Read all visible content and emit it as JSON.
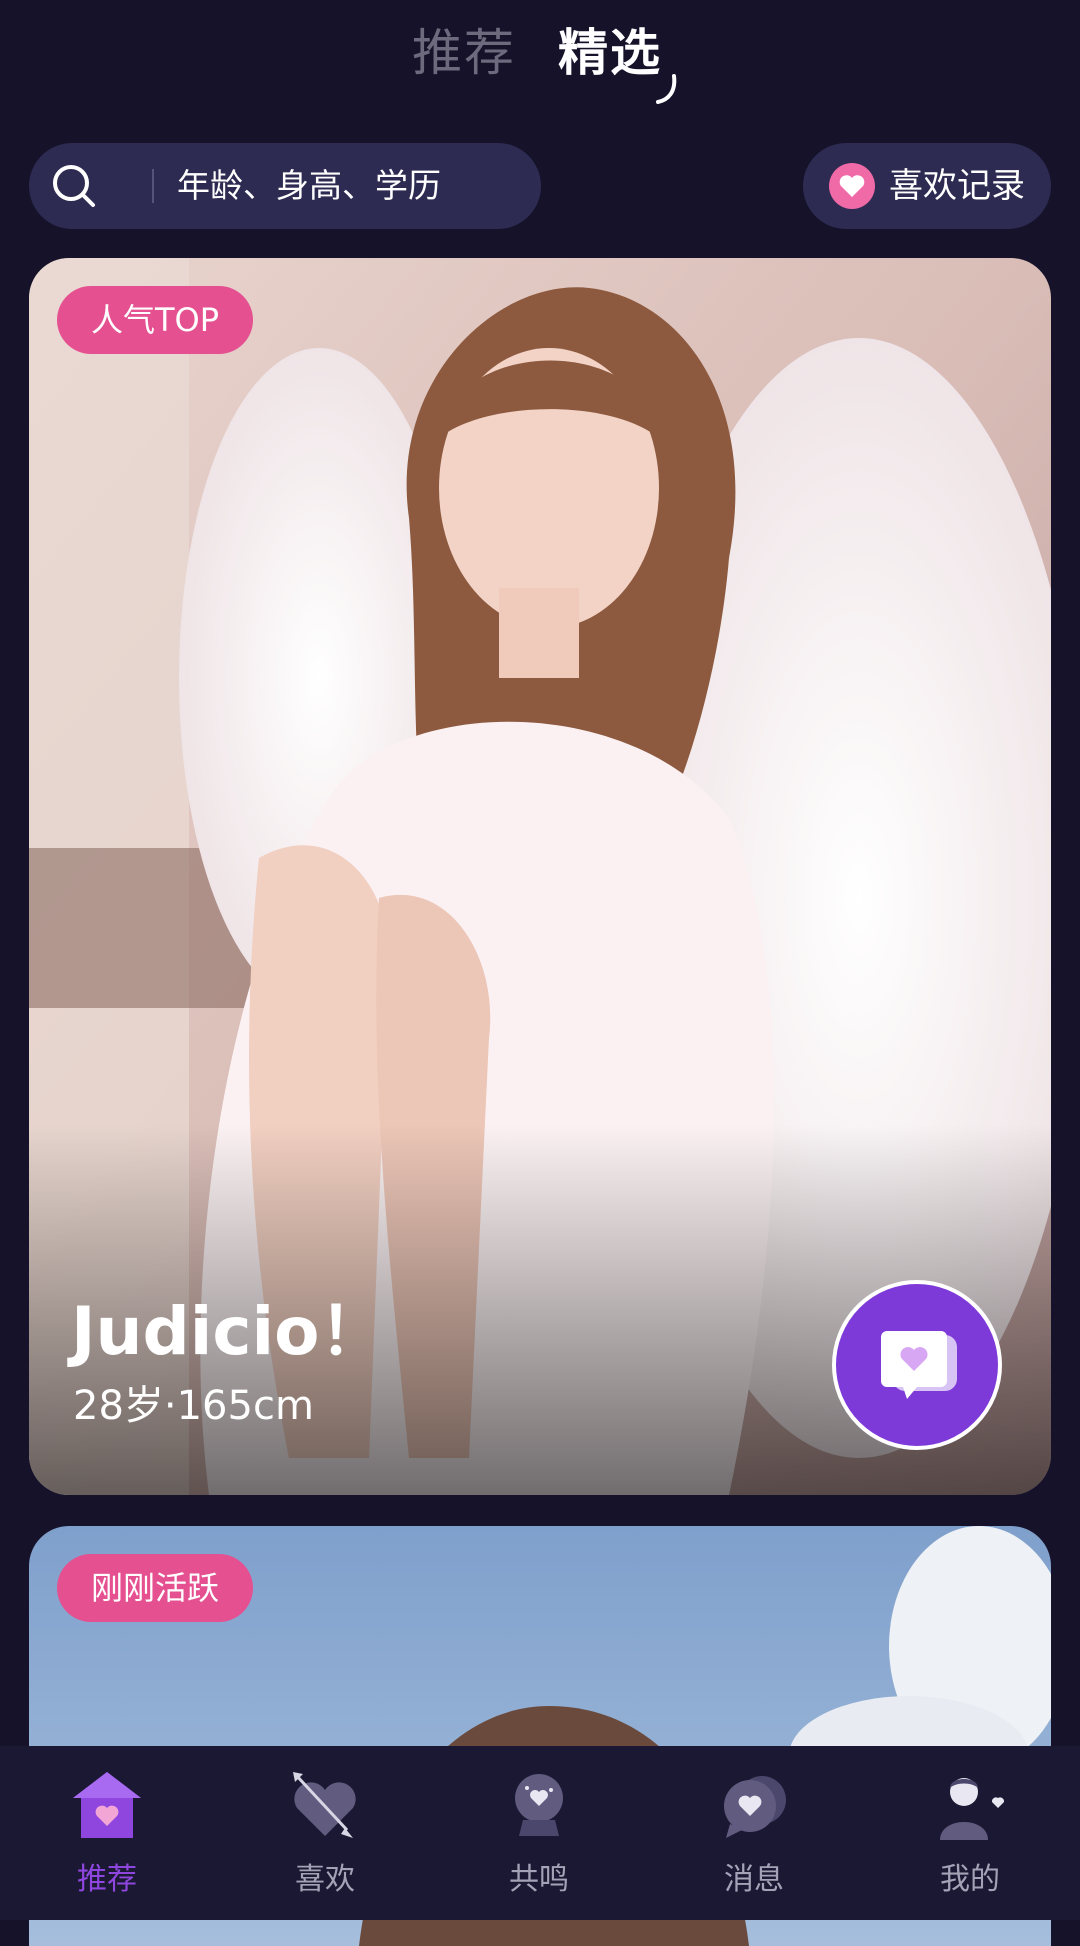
{
  "top_tabs": {
    "recommend": "推荐",
    "featured": "精选",
    "active": "featured"
  },
  "search": {
    "placeholder": "年龄、身高、学历"
  },
  "likes_record": {
    "label": "喜欢记录"
  },
  "cards": [
    {
      "badge": "人气TOP",
      "name": "Judicio！",
      "meta": "28岁·165cm"
    },
    {
      "badge": "刚刚活跃"
    }
  ],
  "bottom_nav": {
    "items": [
      {
        "label": "推荐",
        "icon": "home-heart-icon",
        "active": true
      },
      {
        "label": "喜欢",
        "icon": "heart-arrow-icon",
        "active": false
      },
      {
        "label": "共鸣",
        "icon": "crystal-ball-icon",
        "active": false
      },
      {
        "label": "消息",
        "icon": "chat-heart-icon",
        "active": false
      },
      {
        "label": "我的",
        "icon": "profile-icon",
        "active": false
      }
    ]
  },
  "colors": {
    "background": "#15122a",
    "pill": "#2d2b51",
    "badge_pink": "#e55090",
    "accent_purple": "#8e46df",
    "nav_bg": "#1b1833"
  }
}
